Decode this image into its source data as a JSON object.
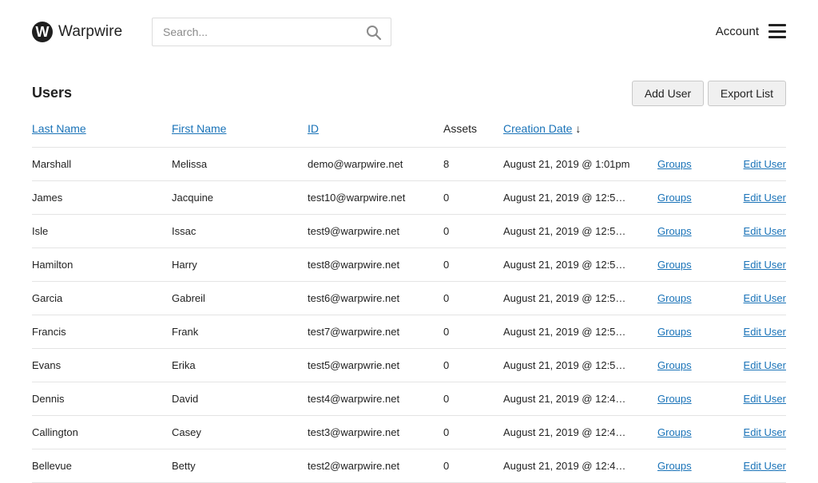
{
  "brand": {
    "name": "Warpwire",
    "mark": "W"
  },
  "search": {
    "placeholder": "Search..."
  },
  "account": {
    "label": "Account"
  },
  "page": {
    "title": "Users"
  },
  "toolbar": {
    "add_user": "Add User",
    "export_list": "Export List"
  },
  "table": {
    "headers": {
      "last_name": "Last Name",
      "first_name": "First Name",
      "id": "ID",
      "assets": "Assets",
      "creation_date": "Creation Date",
      "sort_indicator": "↓"
    },
    "rows": [
      {
        "last": "Marshall",
        "first": "Melissa",
        "id": "demo@warpwire.net",
        "assets": "8",
        "date": "August 21, 2019 @ 1:01pm",
        "groups": "Groups",
        "edit": "Edit User"
      },
      {
        "last": "James",
        "first": "Jacquine",
        "id": "test10@warpwire.net",
        "assets": "0",
        "date": "August 21, 2019 @ 12:5…",
        "groups": "Groups",
        "edit": "Edit User"
      },
      {
        "last": "Isle",
        "first": "Issac",
        "id": "test9@warpwire.net",
        "assets": "0",
        "date": "August 21, 2019 @ 12:5…",
        "groups": "Groups",
        "edit": "Edit User"
      },
      {
        "last": "Hamilton",
        "first": "Harry",
        "id": "test8@warpwire.net",
        "assets": "0",
        "date": "August 21, 2019 @ 12:5…",
        "groups": "Groups",
        "edit": "Edit User"
      },
      {
        "last": "Garcia",
        "first": "Gabreil",
        "id": "test6@warpwire.net",
        "assets": "0",
        "date": "August 21, 2019 @ 12:5…",
        "groups": "Groups",
        "edit": "Edit User"
      },
      {
        "last": "Francis",
        "first": "Frank",
        "id": "test7@warpwire.net",
        "assets": "0",
        "date": "August 21, 2019 @ 12:5…",
        "groups": "Groups",
        "edit": "Edit User"
      },
      {
        "last": "Evans",
        "first": "Erika",
        "id": "test5@warpwrie.net",
        "assets": "0",
        "date": "August 21, 2019 @ 12:5…",
        "groups": "Groups",
        "edit": "Edit User"
      },
      {
        "last": "Dennis",
        "first": "David",
        "id": "test4@warpwire.net",
        "assets": "0",
        "date": "August 21, 2019 @ 12:4…",
        "groups": "Groups",
        "edit": "Edit User"
      },
      {
        "last": "Callington",
        "first": "Casey",
        "id": "test3@warpwire.net",
        "assets": "0",
        "date": "August 21, 2019 @ 12:4…",
        "groups": "Groups",
        "edit": "Edit User"
      },
      {
        "last": "Bellevue",
        "first": "Betty",
        "id": "test2@warpwire.net",
        "assets": "0",
        "date": "August 21, 2019 @ 12:4…",
        "groups": "Groups",
        "edit": "Edit User"
      }
    ]
  },
  "colors": {
    "link": "#1a73b8",
    "text": "#222222",
    "border": "#e4e4e4",
    "button_bg": "#f0f0f0"
  }
}
